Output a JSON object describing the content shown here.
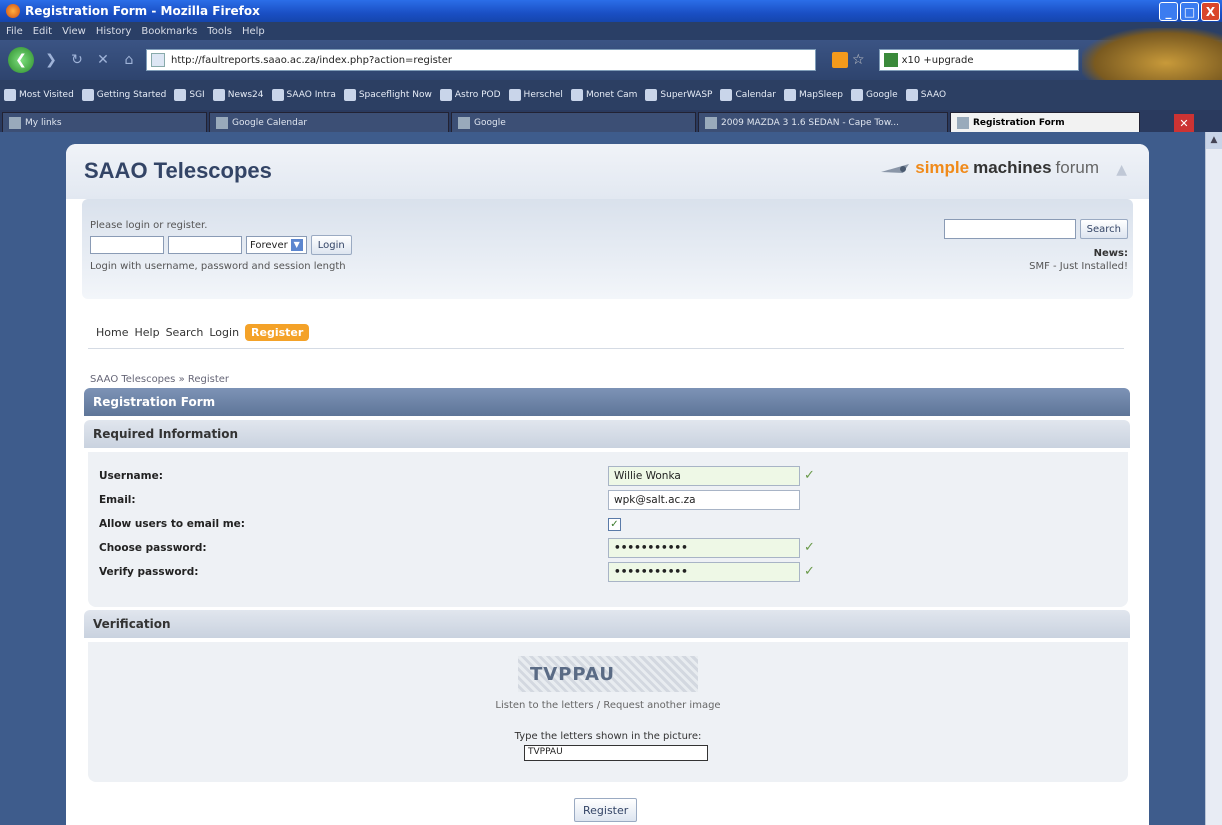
{
  "window": {
    "title": "Registration Form - Mozilla Firefox",
    "controls": [
      "_",
      "□",
      "X"
    ]
  },
  "browser": {
    "menu": [
      "File",
      "Edit",
      "View",
      "History",
      "Bookmarks",
      "Tools",
      "Help"
    ],
    "url": "http://faultreports.saao.ac.za/index.php?action=register",
    "search_value": "x10 +upgrade",
    "bookmarks": [
      "Most Visited",
      "Getting Started",
      "SGI",
      "News24",
      "SAAO Intra",
      "Spaceflight Now",
      "Astro POD",
      "Herschel",
      "Monet Cam",
      "SuperWASP",
      "Calendar",
      "MapSleep",
      "Google",
      "SAAO"
    ],
    "tabs": [
      {
        "label": "My links",
        "active": false
      },
      {
        "label": "Google Calendar",
        "active": false
      },
      {
        "label": "Google",
        "active": false
      },
      {
        "label": "2009 MAZDA 3 1.6 SEDAN - Cape Tow...",
        "active": false
      },
      {
        "label": "Registration Form",
        "active": true
      }
    ]
  },
  "forum": {
    "title": "SAAO Telescopes",
    "logo": {
      "simple": "simple",
      "machines": "machines",
      "forum": "forum"
    }
  },
  "user": {
    "prompt": "Please login or register.",
    "session_length": "Forever",
    "login_button": "Login",
    "hint": "Login with username, password and session length",
    "search_button": "Search",
    "news_label": "News:",
    "news_text": "SMF - Just Installed!"
  },
  "menu": {
    "items": [
      "Home",
      "Help",
      "Search",
      "Login",
      "Register"
    ],
    "active": "Register"
  },
  "linktree": "SAAO Telescopes » Register",
  "form": {
    "header": "Registration Form",
    "required_title": "Required Information",
    "username_label": "Username:",
    "username_value": "Willie Wonka",
    "email_label": "Email:",
    "email_value": "wpk@salt.ac.za",
    "allow_email_label": "Allow users to email me:",
    "allow_email_checked": true,
    "password_label": "Choose password:",
    "password_value": "•••••••••••",
    "verify_label": "Verify password:",
    "verify_value": "•••••••••••",
    "verification_title": "Verification",
    "captcha_text": "TVPPAU",
    "captcha_links": "Listen to the letters / Request another image",
    "captcha_prompt": "Type the letters shown in the picture:",
    "captcha_value": "TVPPAU",
    "submit": "Register"
  },
  "colors": {
    "accent": "#f4a228",
    "catbar": "#5e7598",
    "valid_field": "#eef8e6"
  }
}
